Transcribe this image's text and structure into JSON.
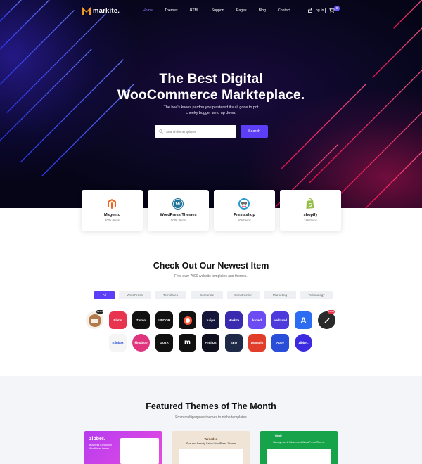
{
  "nav": {
    "logo": "markite.",
    "items": [
      "Home",
      "Themes",
      "HTML",
      "Support",
      "Pages",
      "Blog",
      "Contact"
    ],
    "active_index": 0,
    "login": "Log In",
    "cart_count": "0"
  },
  "hero": {
    "title_line1": "The Best Digital",
    "title_line2": "WooCommerce Markteplace.",
    "subtitle": "The bee's knees pardon you plastered it's all gone to pot cheeky bugger wind up down.",
    "search_placeholder": "Search for templates",
    "search_button": "Search"
  },
  "categories": [
    {
      "name": "Magento",
      "count": "200k Items",
      "icon": "magento-icon",
      "color": "#f26322"
    },
    {
      "name": "WordPress Themes",
      "count": "500k Items",
      "icon": "wordpress-icon",
      "color": "#21759b"
    },
    {
      "name": "Prestashop",
      "count": "50k Items",
      "icon": "prestashop-icon",
      "color": "#2a9bd2"
    },
    {
      "name": "shopify",
      "count": "18k Items",
      "icon": "shopify-icon",
      "color": "#95bf47"
    }
  ],
  "newest": {
    "title": "Check Out Our Newest Item",
    "subtitle": "Find over 7000 website templates and themes.",
    "filters": [
      "All",
      "WordPress",
      "Templates",
      "Corporate",
      "Construction",
      "Marketing",
      "Technology"
    ],
    "active_filter": 0,
    "items_row1": [
      {
        "label": "",
        "color": "#f4eee6",
        "icon": "coffee-logo-icon",
        "tag": "+1321"
      },
      {
        "label": "Platin",
        "color": "#e8344d",
        "icon": "platin-logo-icon"
      },
      {
        "label": "Ziston",
        "color": "#111111",
        "icon": "ziston-logo-icon"
      },
      {
        "label": "UNOOR",
        "color": "#111111",
        "icon": "unoor-logo-icon"
      },
      {
        "label": "",
        "color": "#111111",
        "icon": "food-logo-icon"
      },
      {
        "label": "tulipa",
        "color": "#16163a",
        "icon": "tulipa-logo-icon"
      },
      {
        "label": "Markite",
        "color": "#3a2ab0",
        "icon": "markite-logo-icon"
      },
      {
        "label": "krowd",
        "color": "#6c4cf2",
        "icon": "krowd-logo-icon"
      },
      {
        "label": "wellLand",
        "color": "#4e3adb",
        "icon": "welland-logo-icon"
      },
      {
        "label": "A",
        "color": "#2b6cf0",
        "icon": "a-logo-icon"
      },
      {
        "label": "",
        "color": "#2a2a2a",
        "icon": "dollar-logo-icon",
        "tag": "+1234"
      }
    ],
    "items_row2": [
      {
        "label": "Klinbox",
        "color": "#f5f5f5",
        "icon": "klinbox-logo-icon"
      },
      {
        "label": "kimaboo",
        "color": "#e0347e",
        "icon": "kimaboo-logo-icon"
      },
      {
        "label": "GOTA",
        "color": "#111111",
        "icon": "gota-logo-icon"
      },
      {
        "label": "m",
        "color": "#111111",
        "icon": "m-logo-icon"
      },
      {
        "label": "Find Us",
        "color": "#0f0f1e",
        "icon": "findus-logo-icon"
      },
      {
        "label": "SEO",
        "color": "#1e2a48",
        "icon": "seo-logo-icon"
      },
      {
        "label": "Donatlio",
        "color": "#e23d2b",
        "icon": "donatlio-logo-icon"
      },
      {
        "label": "Appy",
        "color": "#2a4ed8",
        "icon": "appy-logo-icon"
      },
      {
        "label": "zibber.",
        "color": "#3b2ae0",
        "icon": "zibber-logo-icon"
      }
    ]
  },
  "featured": {
    "title": "Featured Themes of The Month",
    "subtitle": "From multipurpose themes to niche templates",
    "cards": [
      {
        "label": "zibber.",
        "color": "#c63cf0",
        "caption": "Business Consulting WordPress theme"
      },
      {
        "label": "Wreedex",
        "color": "#efe4d5",
        "caption": "Spa and Beauty Salon WordPress Theme"
      },
      {
        "label": "Geoll",
        "color": "#17a34a",
        "caption": "Handyman & Movement WordPress Theme"
      }
    ]
  },
  "colors": {
    "accent": "#5b3ef5",
    "hero_bg": "#070618"
  }
}
